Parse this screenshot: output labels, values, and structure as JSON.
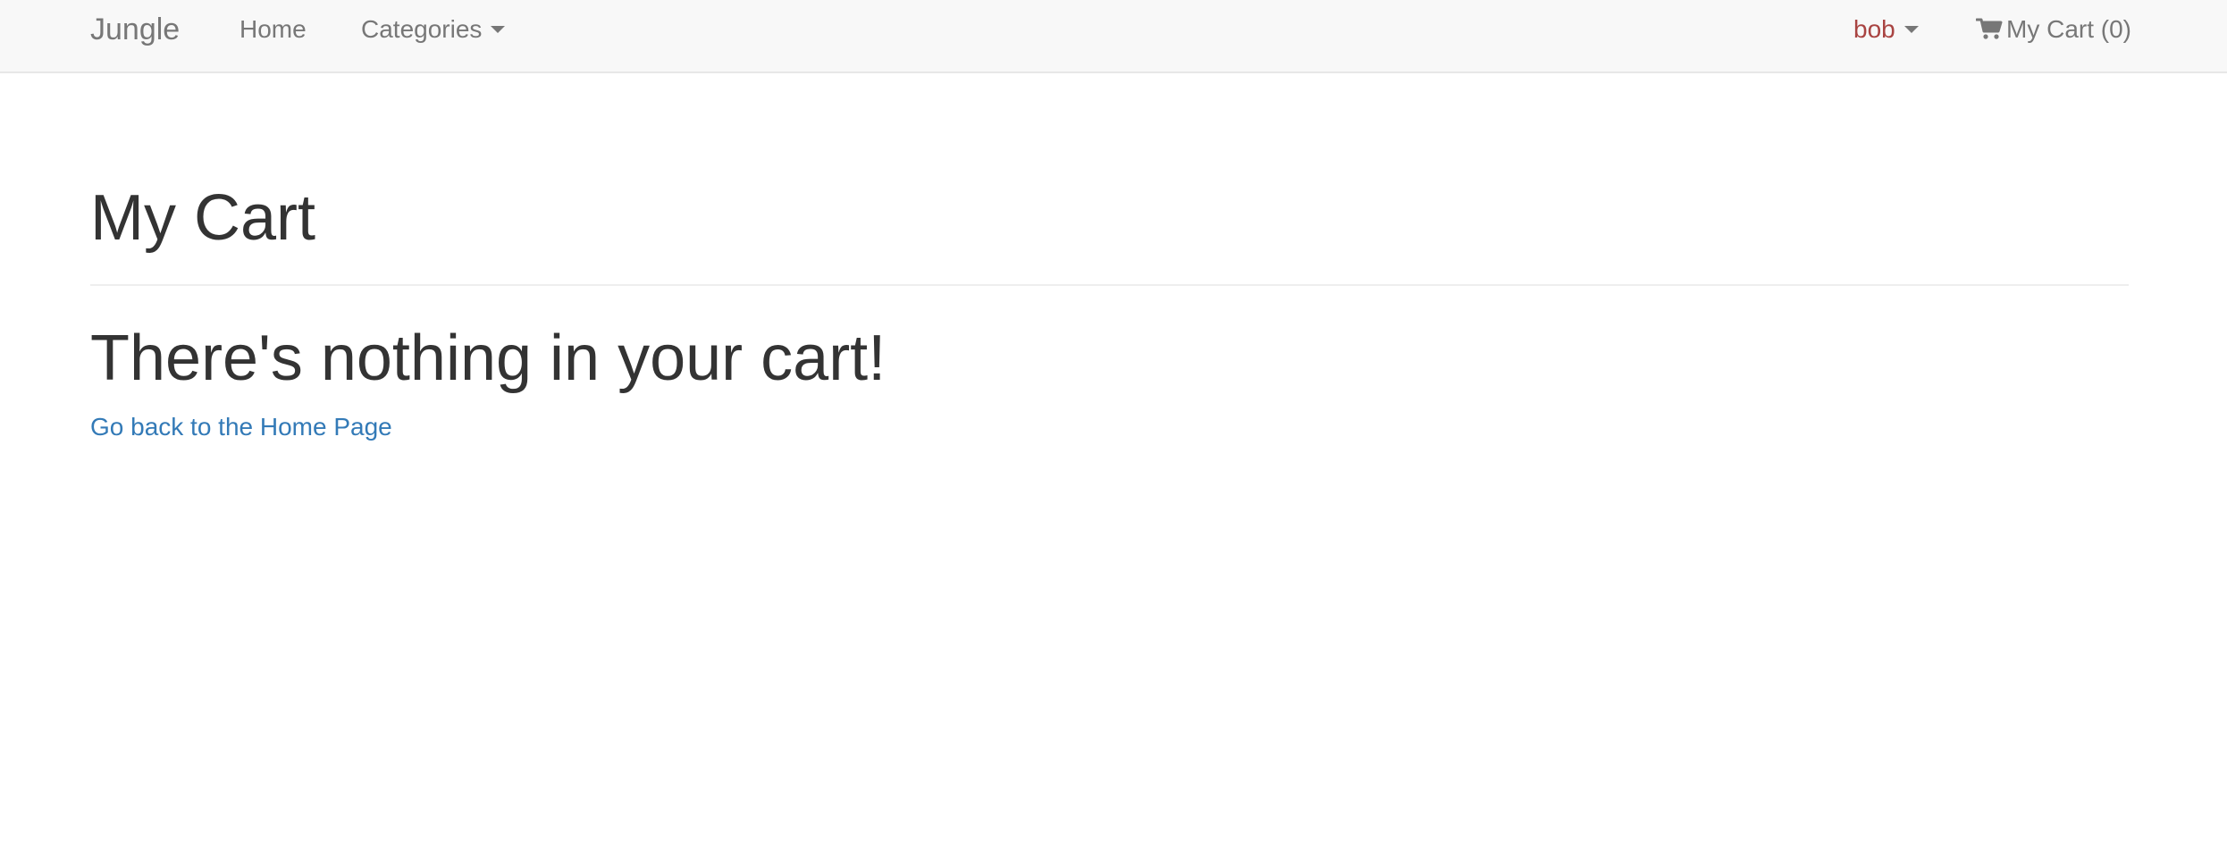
{
  "navbar": {
    "brand": "Jungle",
    "items": {
      "home": "Home",
      "categories": "Categories"
    },
    "user": "bob",
    "cart_label": "My Cart (0)"
  },
  "main": {
    "title": "My Cart",
    "empty_message": "There's nothing in your cart!",
    "home_link": "Go back to the Home Page"
  },
  "colors": {
    "navbar_bg": "#f8f8f8",
    "nav_text": "#777777",
    "user_text": "#a94442",
    "link": "#337ab7",
    "heading": "#333333"
  },
  "icons": {
    "cart": "shopping-cart-icon",
    "dropdown": "caret-down-icon"
  }
}
